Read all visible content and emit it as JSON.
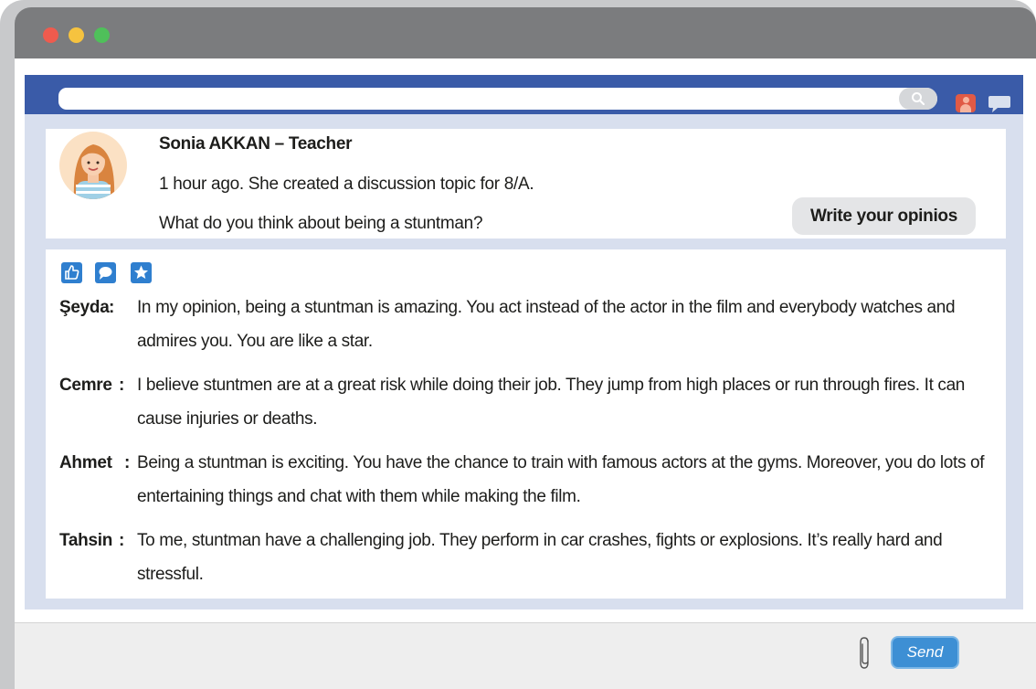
{
  "window": {
    "controls": [
      "close",
      "minimize",
      "maximize"
    ]
  },
  "search": {
    "value": "",
    "placeholder": ""
  },
  "post": {
    "author": "Sonia AKKAN – Teacher",
    "meta": "1 hour ago. She created a discussion topic for 8/A.",
    "topic": "What do you think about being a stuntman?",
    "write_button": "Write your opinios"
  },
  "reactions": [
    "thumbs-up-icon",
    "comment-icon",
    "star-icon"
  ],
  "comments": [
    {
      "name": "Şeyda",
      "text": "In my opinion, being a stuntman is amazing. You act instead of the actor in the film and everybody watches and admires you. You are like a star."
    },
    {
      "name": "Cemre",
      "text": "I believe stuntmen are at a great risk while doing their job. They jump from high places or run through fires. It can cause injuries or deaths."
    },
    {
      "name": "Ahmet",
      "text": "Being a stuntman is exciting. You have the chance to train with famous actors at the gyms. Moreover, you do lots of entertaining things and chat with them while making the film."
    },
    {
      "name": "Tahsin",
      "text": "To me, stuntman have a challenging job. They perform in car crashes, fights or explosions. It’s really hard and stressful."
    }
  ],
  "footer": {
    "send_label": "Send"
  },
  "colors": {
    "titlebar": "#7b7c7e",
    "topbar": "#3a5ba8",
    "frame": "#d8dfee",
    "send": "#3d8fd4",
    "reaction": "#2f7fcf"
  }
}
